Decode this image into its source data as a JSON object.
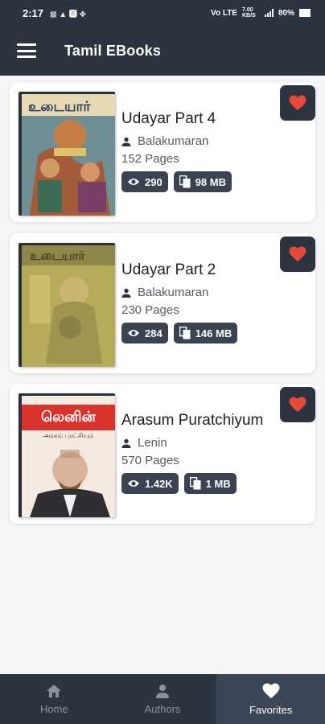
{
  "status_bar": {
    "time": "2:17",
    "left_icons": "⊠ ▲ 🅱 ✥",
    "network": "Vo LTE",
    "speed": "7.00 KB/S",
    "battery": "80%"
  },
  "app_bar": {
    "title": "Tamil EBooks"
  },
  "books": [
    {
      "title": "Udayar Part 4",
      "author": "Balakumaran",
      "pages": "152 Pages",
      "views": "290",
      "size": "98 MB",
      "favorited": true
    },
    {
      "title": "Udayar Part 2",
      "author": "Balakumaran",
      "pages": "230 Pages",
      "views": "284",
      "size": "146 MB",
      "favorited": true
    },
    {
      "title": "Arasum Puratchiyum",
      "author": "Lenin",
      "pages": "570 Pages",
      "views": "1.42K",
      "size": "1 MB",
      "favorited": true,
      "cover_title": "லெனின்",
      "cover_subtitle": "அரசும் புரட்சியும்"
    }
  ],
  "bottom_nav": [
    {
      "label": "Home",
      "icon": "home-icon",
      "active": false
    },
    {
      "label": "Authors",
      "icon": "person-icon",
      "active": false
    },
    {
      "label": "Favorites",
      "icon": "heart-icon",
      "active": true
    }
  ],
  "colors": {
    "bar": "#2c3440",
    "chip": "#3a4352",
    "heart": "#e64a3b",
    "active_nav": "#3b4656"
  }
}
